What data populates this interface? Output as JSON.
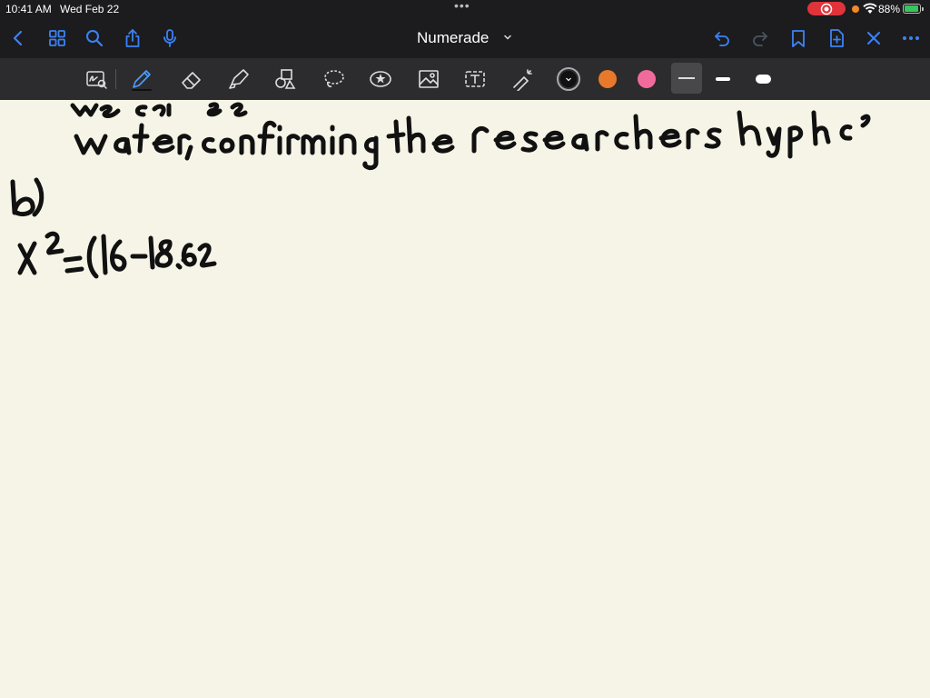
{
  "status_bar": {
    "time": "10:41 AM",
    "date": "Wed Feb 22",
    "battery": "88%",
    "multitask_dots": "•••"
  },
  "nav": {
    "title": "Numerade",
    "icons": [
      "back-icon",
      "grid-icon",
      "search-icon",
      "share-icon",
      "microphone-icon",
      "undo-icon",
      "redo-icon",
      "bookmark-icon",
      "add-page-icon",
      "close-icon",
      "more-icon"
    ]
  },
  "toolbar": {
    "tools": [
      "lasso-handwriting-icon",
      "pen-icon",
      "eraser-icon",
      "highlighter-icon",
      "shapes-icon",
      "lasso-icon",
      "sticker-icon",
      "image-icon",
      "text-icon",
      "laser-pointer-icon"
    ],
    "colors": [
      "#111111",
      "#e8792b",
      "#f06b9c"
    ],
    "stroke_widths": [
      "thin",
      "medium",
      "thick"
    ],
    "selected_stroke": "thin"
  },
  "note": {
    "lines": [
      "we can be",
      "water, confirming the researchers hypothesis",
      "b)",
      "x² = (16 - 18.62"
    ]
  }
}
